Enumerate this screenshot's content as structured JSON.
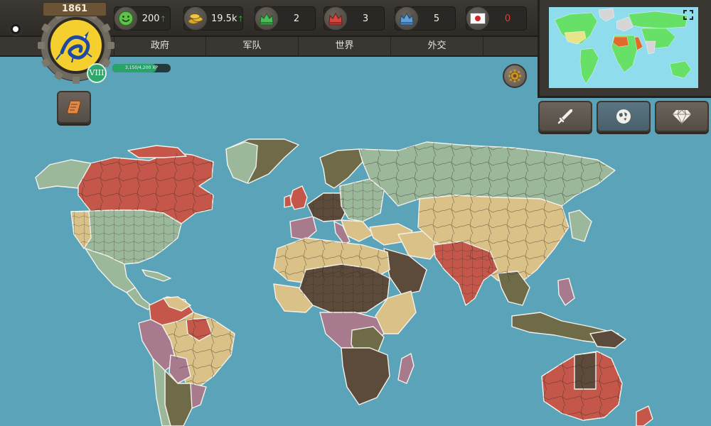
{
  "header": {
    "year": "1861",
    "level": "VIII",
    "xp_text": "3,150/4,200 XP",
    "xp_progress": 0.75
  },
  "stats": [
    {
      "name": "stability",
      "icon": "smiley-icon",
      "value": "200",
      "trend": "up"
    },
    {
      "name": "gold",
      "icon": "gold-coins-icon",
      "value": "19.5k",
      "trend": "up"
    },
    {
      "name": "green-crown",
      "icon": "green-crown-icon",
      "value": "2",
      "trend": ""
    },
    {
      "name": "red-crown",
      "icon": "red-crown-icon",
      "value": "3",
      "trend": ""
    },
    {
      "name": "blue-crown",
      "icon": "blue-crown-icon",
      "value": "5",
      "trend": ""
    },
    {
      "name": "enemy-flag",
      "icon": "japan-flag-icon",
      "value": "0",
      "trend": ""
    }
  ],
  "nav": {
    "government": "政府",
    "army": "军队",
    "world": "世界",
    "diplomacy": "外交"
  },
  "colors": {
    "ocean": "#5aa3b8",
    "player_red": "#c4574a",
    "sage": "#9cb89b",
    "tan": "#d9c187",
    "dark_brown": "#5c4a3a",
    "olive": "#6f6b48",
    "mauve": "#a77a8e",
    "stat_value_red": "#e23a2e"
  },
  "actions": [
    {
      "name": "war",
      "icon": "sword-icon"
    },
    {
      "name": "world",
      "icon": "globe-icon"
    },
    {
      "name": "premium",
      "icon": "diamond-icon"
    }
  ]
}
